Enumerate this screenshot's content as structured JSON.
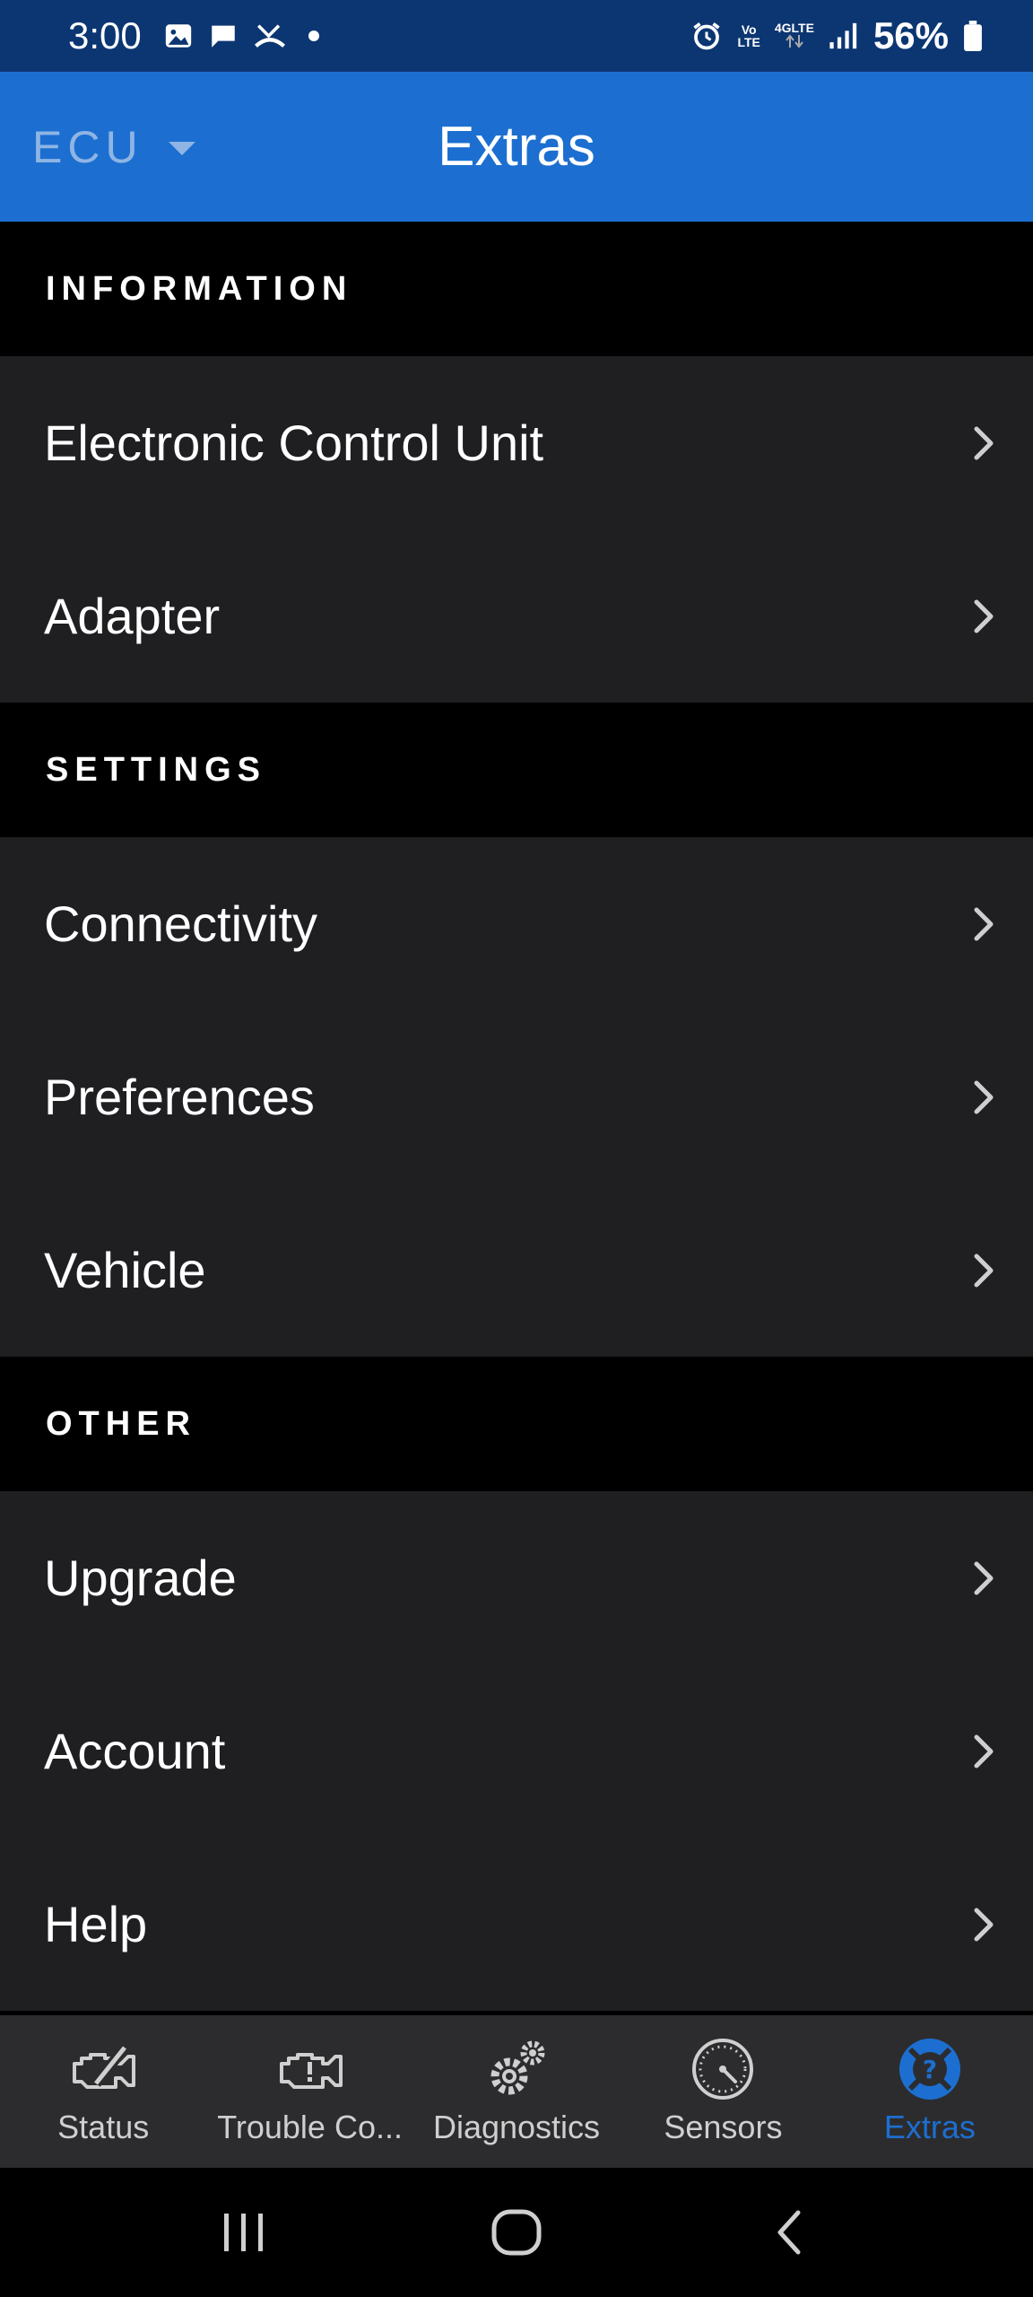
{
  "status_bar": {
    "time": "3:00",
    "network_top": "Vo",
    "network_bottom": "LTE",
    "network_type": "4GLTE",
    "battery": "56%"
  },
  "app_bar": {
    "ecu_label": "ECU",
    "title": "Extras"
  },
  "sections": [
    {
      "header": "INFORMATION",
      "items": [
        {
          "label": "Electronic Control Unit"
        },
        {
          "label": "Adapter"
        }
      ]
    },
    {
      "header": "SETTINGS",
      "items": [
        {
          "label": "Connectivity"
        },
        {
          "label": "Preferences"
        },
        {
          "label": "Vehicle"
        }
      ]
    },
    {
      "header": "OTHER",
      "items": [
        {
          "label": "Upgrade"
        },
        {
          "label": "Account"
        },
        {
          "label": "Help"
        }
      ]
    }
  ],
  "tabs": [
    {
      "label": "Status",
      "icon": "engine-check-icon",
      "active": false
    },
    {
      "label": "Trouble Co...",
      "icon": "engine-warning-icon",
      "active": false
    },
    {
      "label": "Diagnostics",
      "icon": "gears-icon",
      "active": false
    },
    {
      "label": "Sensors",
      "icon": "gauge-icon",
      "active": false
    },
    {
      "label": "Extras",
      "icon": "help-circle-icon",
      "active": true
    }
  ],
  "colors": {
    "status_bar": "#0c3672",
    "app_bar": "#1c6fd0",
    "accent": "#1c6fd0",
    "list_bg": "#1f1f22",
    "section_bg": "#000000",
    "tab_bar": "#2c2c2f"
  }
}
